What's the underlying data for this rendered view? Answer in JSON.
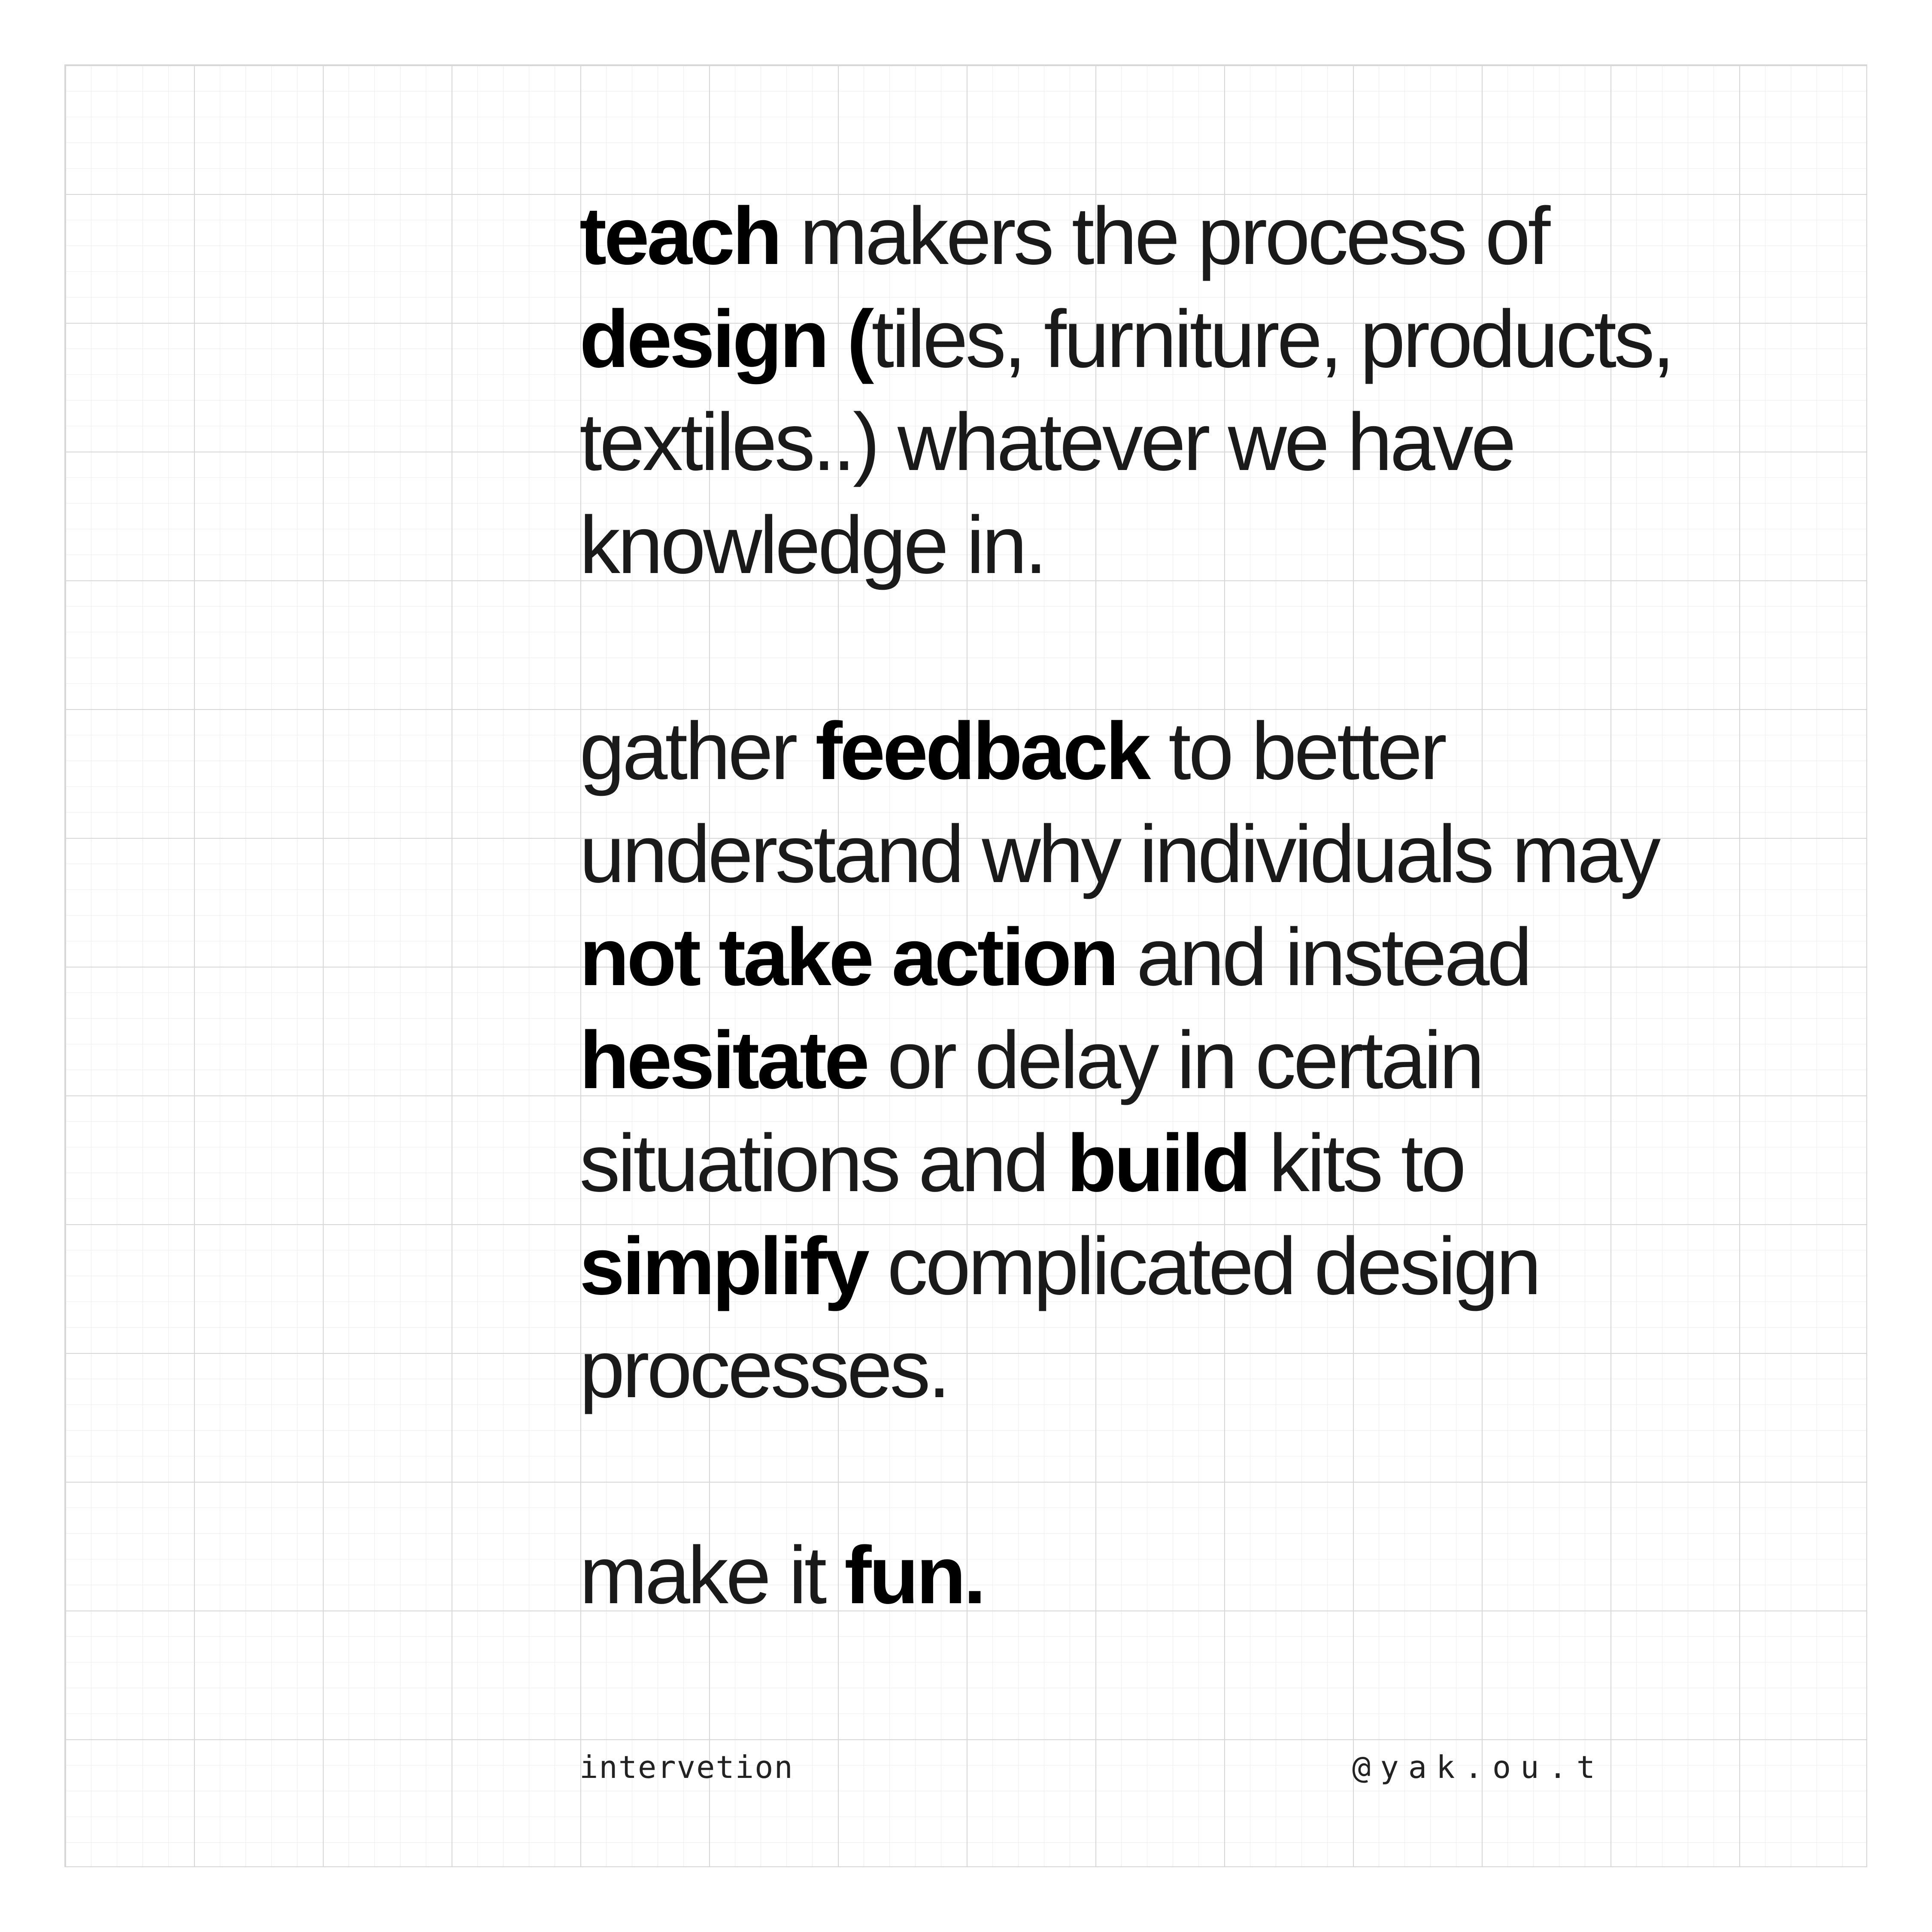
{
  "paragraph_1": {
    "s1": "teach",
    "s2": " makers the process of ",
    "s3": "design (",
    "s4": "tiles, furniture, products, textiles..) whatever we have knowledge in."
  },
  "paragraph_2": {
    "s1": "gather ",
    "s2": "feedback",
    "s3": " to better understand why individuals may ",
    "s4": "not take action",
    "s5": " and instead ",
    "s6": "hesitate",
    "s7": " or delay in certain situations and ",
    "s8": "build",
    "s9": " kits to ",
    "s10": "simplify",
    "s11": " complicated design processes."
  },
  "paragraph_3": {
    "s1": "make it ",
    "s2": "fun."
  },
  "footer": {
    "left": "intervetion",
    "right": "@yak.ou.t"
  }
}
